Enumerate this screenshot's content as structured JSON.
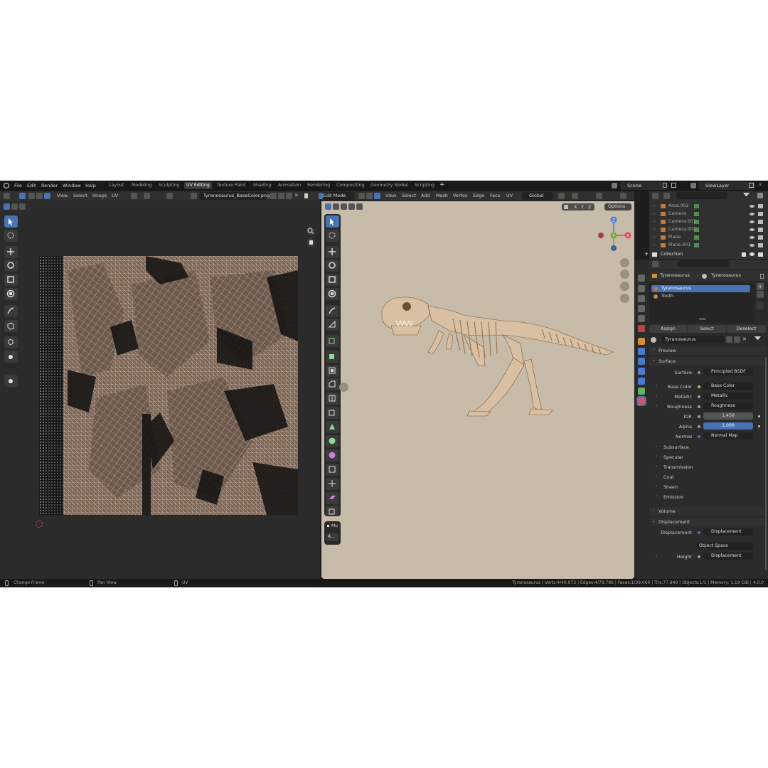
{
  "topbar": {
    "menus": [
      "File",
      "Edit",
      "Render",
      "Window",
      "Help"
    ],
    "workspaces": [
      "Layout",
      "Modeling",
      "Sculpting",
      "UV Editing",
      "Texture Paint",
      "Shading",
      "Animation",
      "Rendering",
      "Compositing",
      "Geometry Nodes",
      "Scripting"
    ],
    "active_workspace": "UV Editing",
    "add_workspace": "+",
    "scene": "Scene",
    "view_layer": "ViewLayer"
  },
  "uv_editor": {
    "menus": [
      "View",
      "Select",
      "Image",
      "UV"
    ],
    "image_name": "Tyranosaurus_BaseColor.png"
  },
  "viewport": {
    "mode": "Edit Mode",
    "menus": [
      "View",
      "Select",
      "Add",
      "Mesh",
      "Vertex",
      "Edge",
      "Face",
      "UV"
    ],
    "orientation": "Global",
    "axes": [
      "X",
      "Y",
      "Z"
    ],
    "options": "Options",
    "gizmo_labels": {
      "z": "Z",
      "x": "X",
      "y": "Y"
    },
    "sidebar_collapsed": "Mu",
    "sidebar_button": "A..."
  },
  "outliner": {
    "items": [
      {
        "name": "Area.002",
        "icon": "light-icon"
      },
      {
        "name": "Camera",
        "icon": "camera-icon"
      },
      {
        "name": "Camera.001",
        "icon": "camera-icon"
      },
      {
        "name": "Camera.002",
        "icon": "camera-icon"
      },
      {
        "name": "Plane",
        "icon": "mesh-icon"
      },
      {
        "name": "Plane.001",
        "icon": "mesh-icon"
      }
    ],
    "collection": "Collection"
  },
  "properties": {
    "breadcrumb_object": "Tyranosaurus",
    "breadcrumb_material": "Tyranosaurus",
    "material_slots": [
      "Tyranosaurus",
      "Tooth"
    ],
    "slot_buttons": [
      "Assign",
      "Select",
      "Deselect"
    ],
    "material_name": "Tyranosaurus",
    "sections": {
      "preview": "Preview",
      "surface": "Surface",
      "volume": "Volume",
      "displacement": "Displacement"
    },
    "surface_rows": [
      {
        "label": "Surface",
        "value": "Principled BSDF",
        "dot": "#5fb55f",
        "style": "dark",
        "expand": false
      },
      {
        "label": "Base Color",
        "value": "Base Color",
        "dot": "#c7c729",
        "style": "dark",
        "expand": true
      },
      {
        "label": "Metallic",
        "value": "Metallic",
        "dot": "#a1a1a1",
        "style": "dark",
        "expand": true
      },
      {
        "label": "Roughness",
        "value": "Roughness",
        "dot": "#a1a1a1",
        "style": "dark",
        "expand": true
      },
      {
        "label": "IOR",
        "value": "1.450",
        "dot": "#a1a1a1",
        "style": "num",
        "expand": false
      },
      {
        "label": "Alpha",
        "value": "1.000",
        "dot": "#a1a1a1",
        "style": "blue",
        "expand": false
      },
      {
        "label": "Normal",
        "value": "Normal Map",
        "dot": "#6363c7",
        "style": "dark",
        "expand": false
      }
    ],
    "subsections": [
      "Subsurface",
      "Specular",
      "Transmission",
      "Coat",
      "Sheen",
      "Emission"
    ],
    "displacement_rows": [
      {
        "label": "Displacement",
        "value": "Displacement",
        "dot": "#6363c7",
        "style": "dark"
      },
      {
        "label": "",
        "value": "Object Space",
        "dot": "",
        "style": "select"
      },
      {
        "label": "Height",
        "value": "Displacement",
        "dot": "#a1a1a1",
        "style": "dark"
      }
    ]
  },
  "status": {
    "left": "Change Frame",
    "middle": "Pan View",
    "right_label": "UV",
    "stats": "Tyranosaurus | Verts:4/40,973 | Edges:4/79,786 | Faces:1/39,060 | Tris:77,840 | Objects:1/1 | Memory: 1.19 GiB | 4.0.0"
  },
  "colors": {
    "accent": "#4772b3",
    "viewport_bg": "#c7bba9",
    "uv_bg": "#2b2b2b",
    "bone": "#d9c0a3"
  }
}
